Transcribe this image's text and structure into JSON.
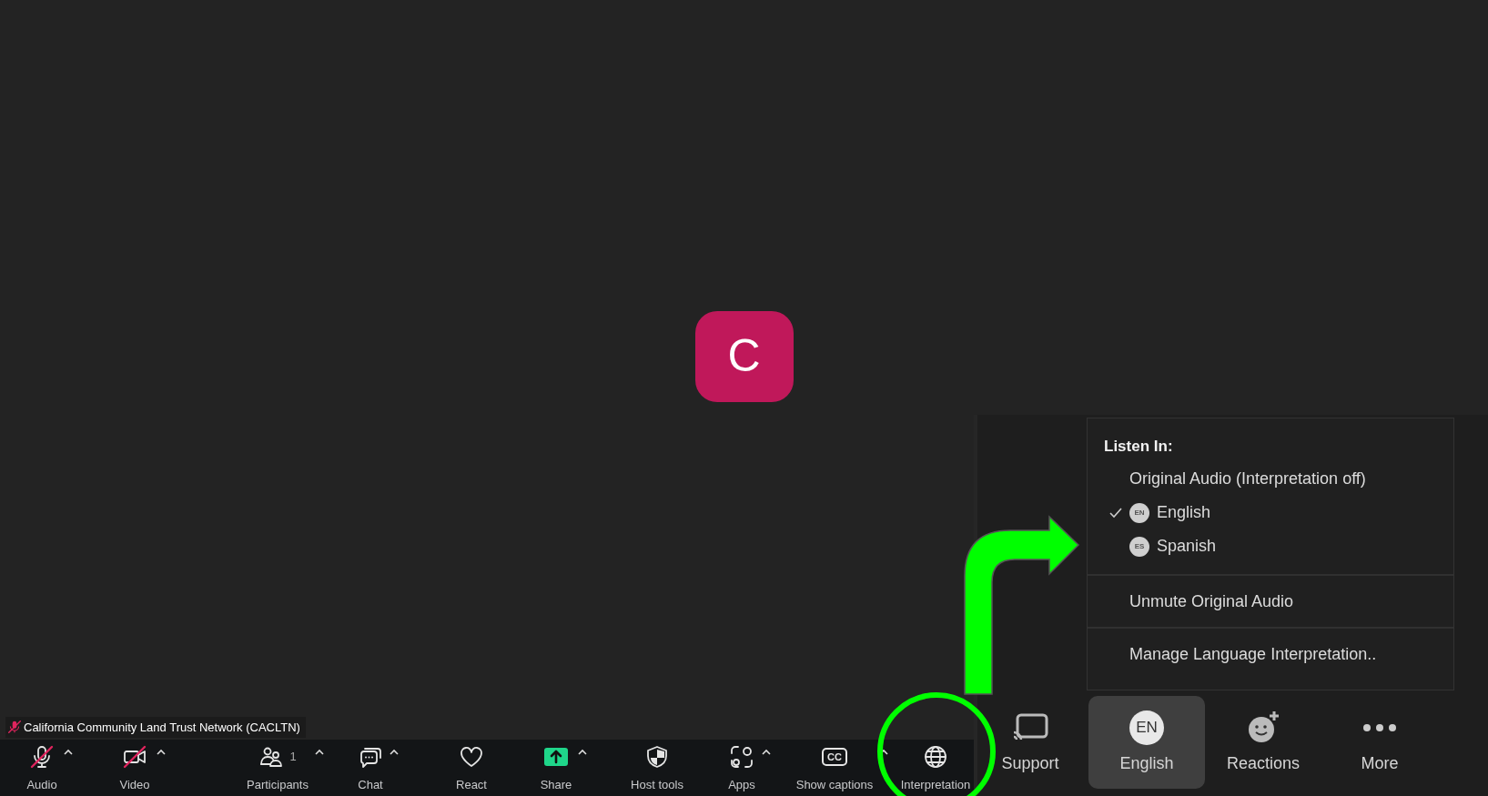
{
  "meeting": {
    "avatar_letter": "C",
    "participant_name": "California Community Land Trust Network (CACLTN)",
    "participant_muted": true
  },
  "toolbar": [
    {
      "kind": "audio",
      "label": "Audio",
      "caret": true,
      "off": true
    },
    {
      "kind": "video",
      "label": "Video",
      "caret": true,
      "off": true
    },
    {
      "kind": "participants",
      "label": "Participants",
      "count": "1",
      "caret": true,
      "off": false
    },
    {
      "kind": "chat",
      "label": "Chat",
      "caret": true,
      "off": false
    },
    {
      "kind": "react",
      "label": "React",
      "caret": false,
      "off": false
    },
    {
      "kind": "share",
      "label": "Share",
      "caret": true,
      "off": false
    },
    {
      "kind": "host_tools",
      "label": "Host tools",
      "caret": false,
      "off": false
    },
    {
      "kind": "apps",
      "label": "Apps",
      "caret": true,
      "off": false
    },
    {
      "kind": "captions",
      "label": "Show captions",
      "icon_text": "CC",
      "caret": true,
      "off": false
    },
    {
      "kind": "interpretation",
      "label": "Interpretation",
      "caret": false,
      "off": false
    }
  ],
  "inset": {
    "menu": {
      "heading": "Listen In:",
      "options": [
        {
          "label": "Original Audio (Interpretation off)",
          "selected": false
        },
        {
          "label": "English",
          "badge": "EN",
          "selected": true
        },
        {
          "label": "Spanish",
          "badge": "ES",
          "selected": false
        }
      ],
      "actions": [
        "Unmute Original Audio",
        "Manage Language Interpretation.."
      ]
    },
    "toolbar": [
      {
        "kind": "support",
        "label": "Support",
        "selected": false
      },
      {
        "kind": "language",
        "label": "English",
        "badge": "EN",
        "selected": true
      },
      {
        "kind": "reactions",
        "label": "Reactions",
        "selected": false
      },
      {
        "kind": "more",
        "label": "More",
        "selected": false
      }
    ]
  }
}
